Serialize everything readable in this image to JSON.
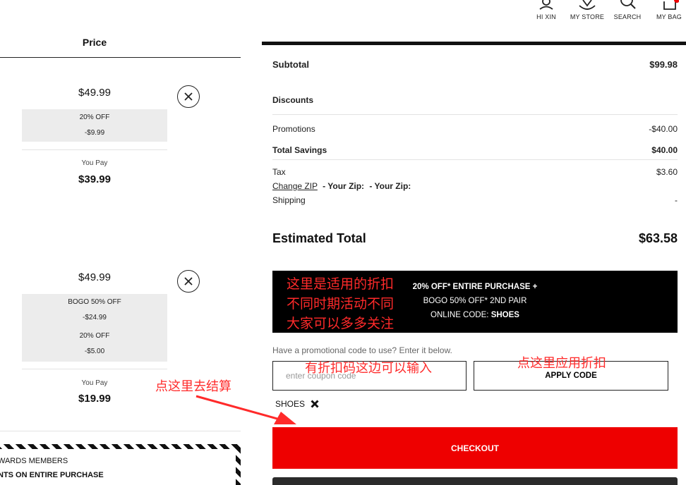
{
  "header": {
    "nav": [
      {
        "label": "HI XIN",
        "icon": "user-icon"
      },
      {
        "label": "MY STORE",
        "icon": "store-pin-icon"
      },
      {
        "label": "SEARCH",
        "icon": "search-icon"
      },
      {
        "label": "MY BAG",
        "icon": "bag-icon"
      }
    ]
  },
  "cart": {
    "price_header": "Price",
    "items": [
      {
        "price": "$49.99",
        "discounts": [
          {
            "name": "20% OFF",
            "amount": "-$9.99"
          }
        ],
        "you_pay_label": "You Pay",
        "you_pay": "$39.99"
      },
      {
        "price": "$49.99",
        "discounts": [
          {
            "name": "BOGO 50% OFF",
            "amount": "-$24.99"
          },
          {
            "name": "20% OFF",
            "amount": "-$5.00"
          }
        ],
        "you_pay_label": "You Pay",
        "you_pay": "$19.99"
      }
    ],
    "rewards_line1": "WARDS MEMBERS",
    "rewards_line2": "NTS ON ENTIRE PURCHASE"
  },
  "summary": {
    "subtotal_label": "Subtotal",
    "subtotal": "$99.98",
    "discounts_label": "Discounts",
    "promotions_label": "Promotions",
    "promotions": "-$40.00",
    "total_savings_label": "Total Savings",
    "total_savings": "$40.00",
    "tax_label": "Tax",
    "tax": "$3.60",
    "change_zip_label": "Change ZIP",
    "your_zip_1": "- Your Zip:",
    "your_zip_2": "- Your Zip:",
    "shipping_label": "Shipping",
    "shipping": "-",
    "estimated_total_label": "Estimated Total",
    "estimated_total": "$63.58"
  },
  "promo_banner": {
    "line1": "20% OFF* ENTIRE PURCHASE +",
    "line2": "BOGO 50% OFF* 2ND PAIR",
    "line3_prefix": "ONLINE CODE: ",
    "line3_code": "SHOES"
  },
  "coupon": {
    "prompt": "Have a promotional code to use? Enter it below.",
    "placeholder": "enter coupon code",
    "apply_label": "APPLY CODE",
    "applied_code": "SHOES"
  },
  "checkout_label": "CHECKOUT",
  "annotations": {
    "promo_note_1": "这里是适用的折扣",
    "promo_note_2": "不同时期活动不同",
    "promo_note_3": "大家可以多多关注",
    "coupon_note": "有折扣码这边可以输入",
    "apply_note": "点这里应用折扣",
    "checkout_note": "点这里去结算",
    "color": "#ff2a2a"
  }
}
